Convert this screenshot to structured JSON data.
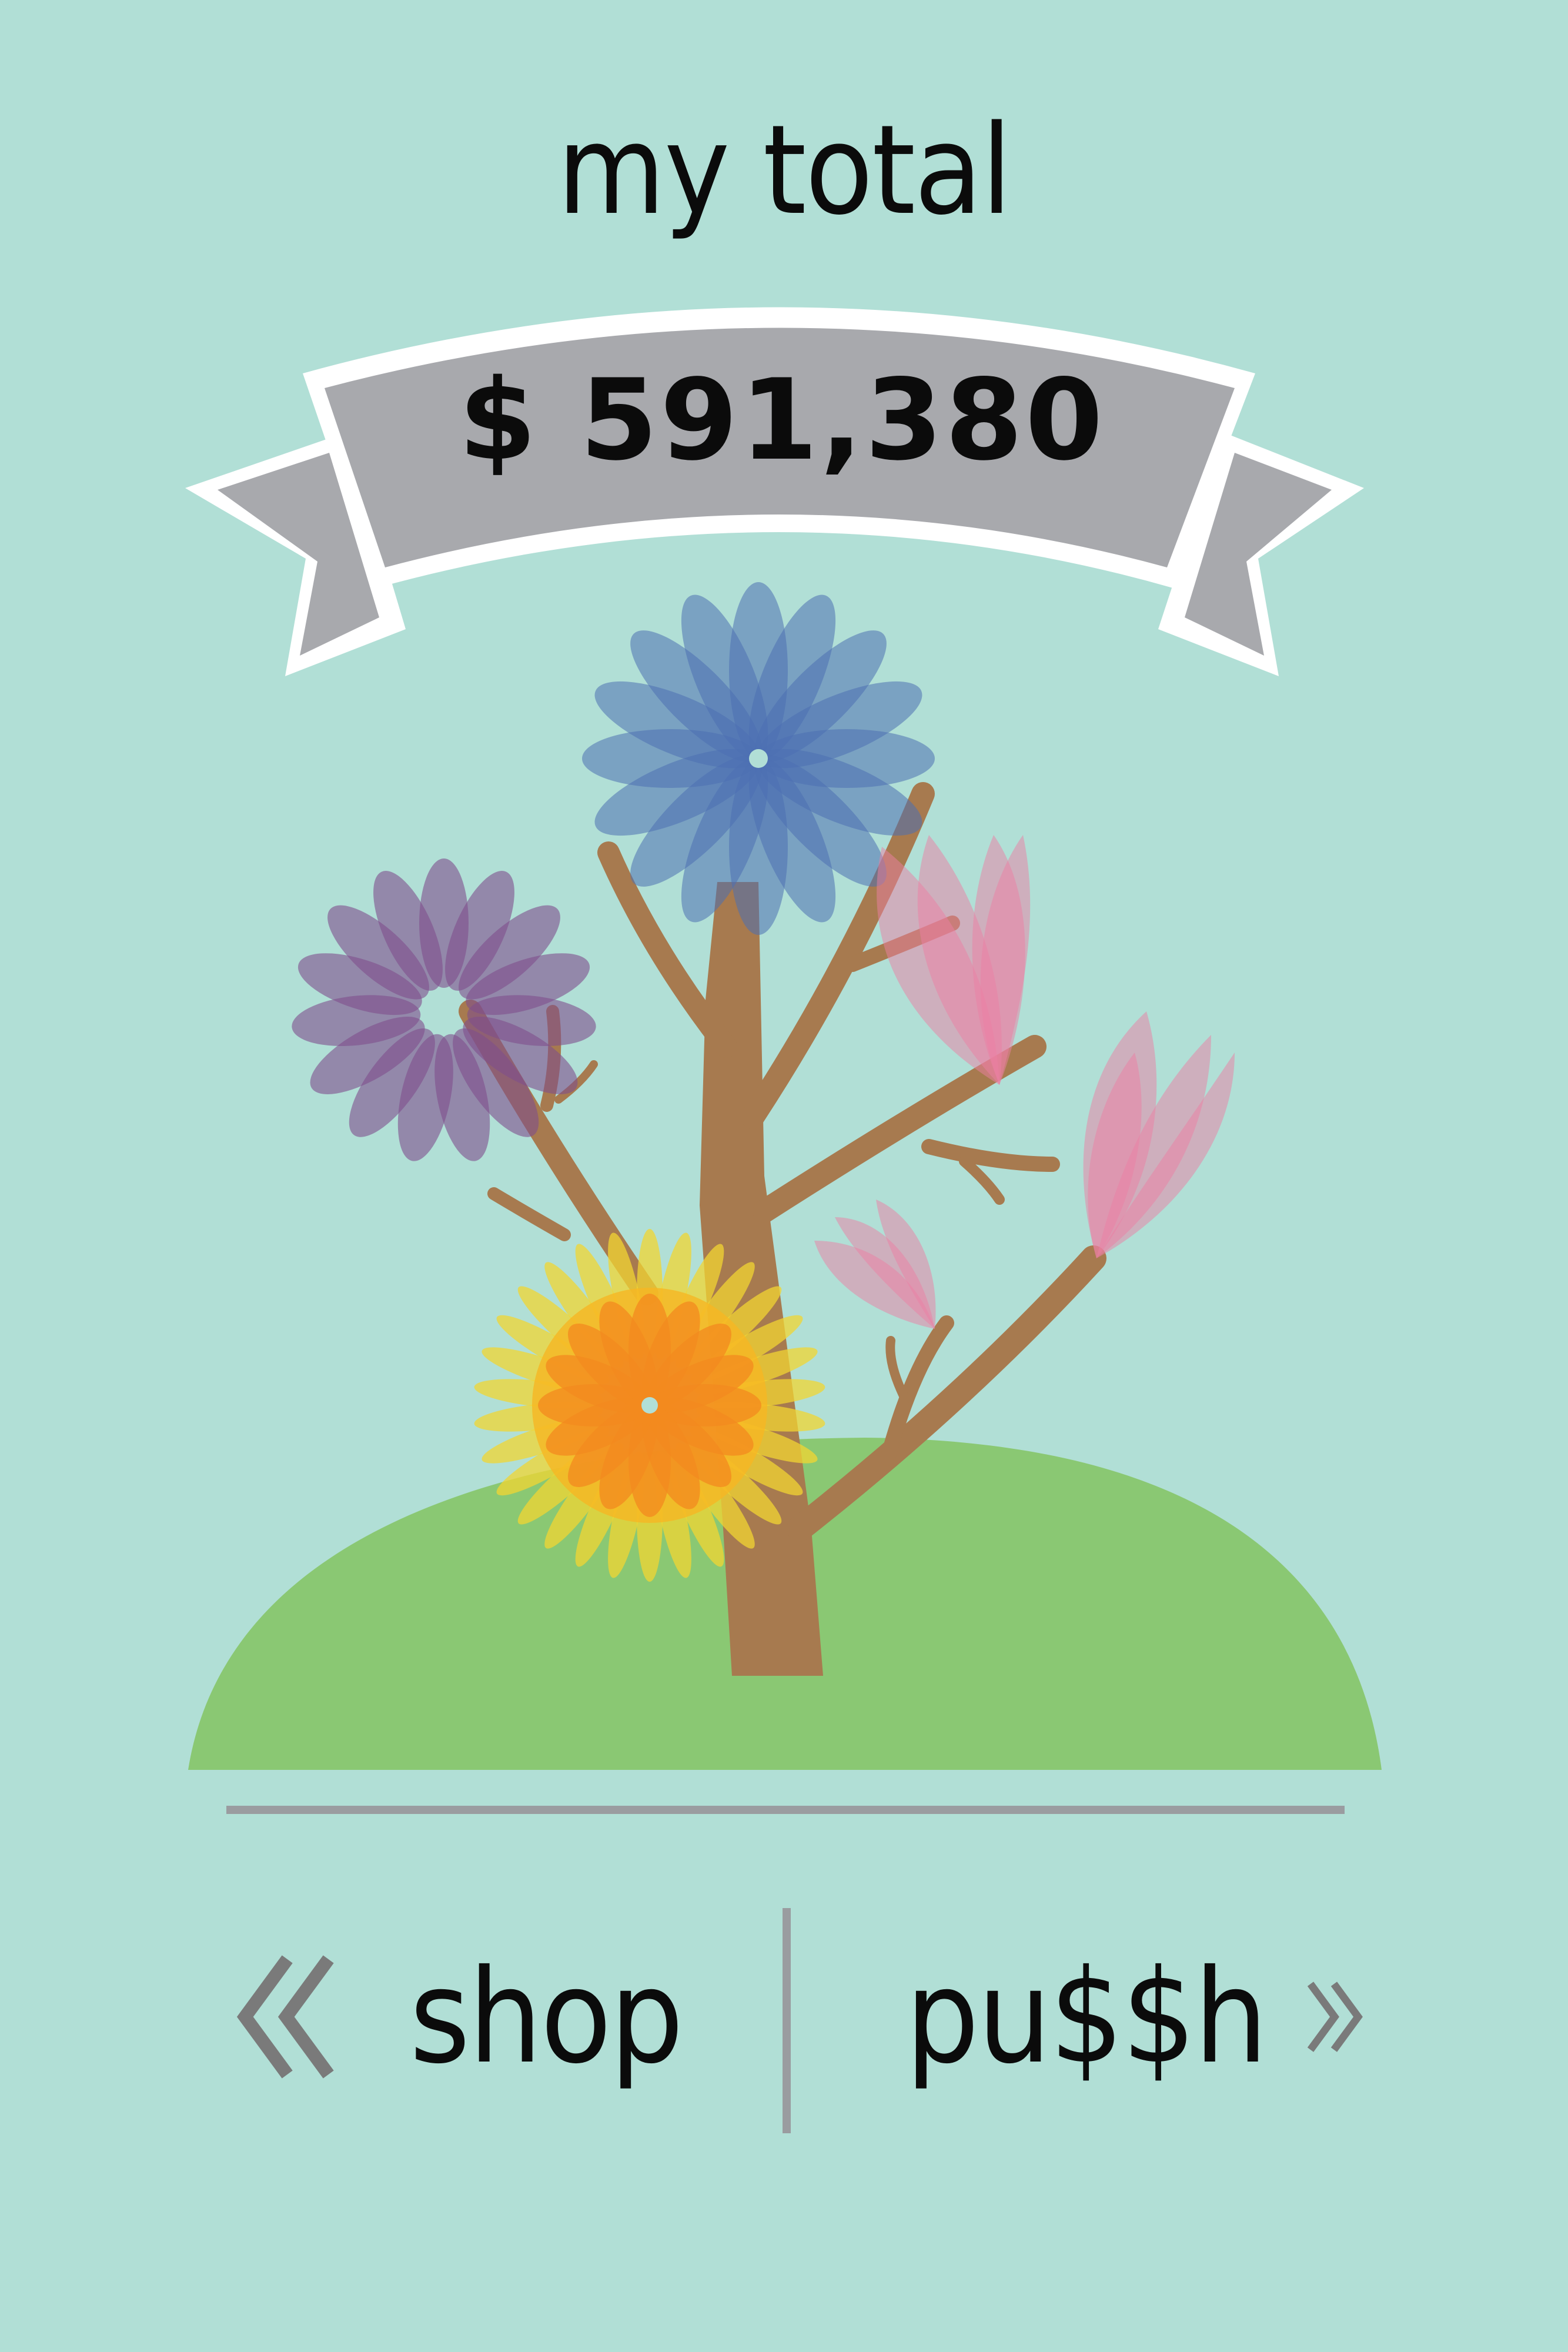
{
  "header": {
    "title": "my total"
  },
  "total": {
    "amount": "$ 591,380"
  },
  "nav": {
    "shop_label": "shop",
    "push_label": "pu$$h",
    "left_icon": "double-chevron-left-icon",
    "right_icon": "double-chevron-right-icon"
  },
  "colors": {
    "background": "#b1dfd6",
    "banner": "#a8a9ad",
    "hill": "#8ac873",
    "trunk": "#a77a4f",
    "divider": "#9a9ca0"
  }
}
